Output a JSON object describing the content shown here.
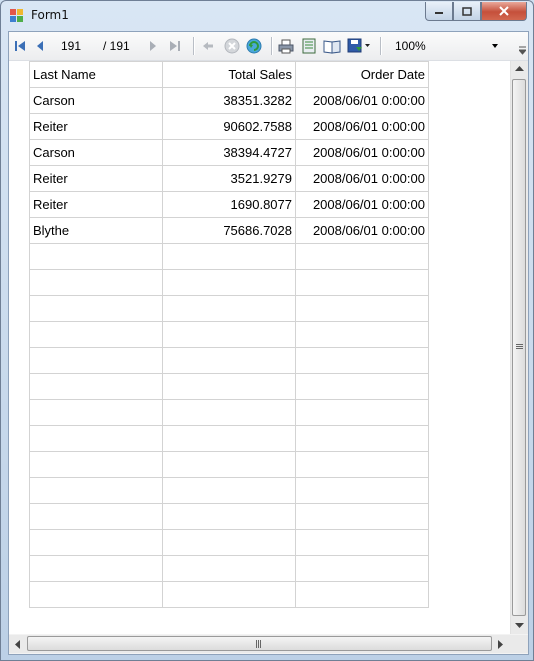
{
  "window": {
    "title": "Form1"
  },
  "toolbar": {
    "current_page": "191",
    "total_pages": "/ 191",
    "zoom": "100%"
  },
  "table": {
    "headers": [
      "Last Name",
      "Total Sales",
      "Order Date"
    ],
    "rows": [
      [
        "Carson",
        "38351.3282",
        "2008/06/01 0:00:00"
      ],
      [
        "Reiter",
        "90602.7588",
        "2008/06/01 0:00:00"
      ],
      [
        "Carson",
        "38394.4727",
        "2008/06/01 0:00:00"
      ],
      [
        "Reiter",
        "3521.9279",
        "2008/06/01 0:00:00"
      ],
      [
        "Reiter",
        "1690.8077",
        "2008/06/01 0:00:00"
      ],
      [
        "Blythe",
        "75686.7028",
        "2008/06/01 0:00:00"
      ]
    ],
    "empty_rows": 14
  },
  "colors": {
    "accent_blue": "#3b6fb6",
    "refresh_green": "#2f9a3a"
  }
}
